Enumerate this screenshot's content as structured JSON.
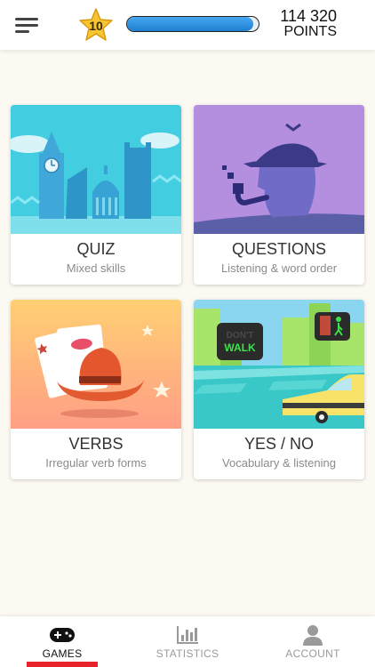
{
  "header": {
    "menu_icon": "hamburger-menu-icon",
    "level": "10",
    "progress_fraction": 0.96,
    "points_value": "114 320",
    "points_label": "POINTS",
    "colors": {
      "star": "#f6c531",
      "progress": "#2b8fe0"
    }
  },
  "games": [
    {
      "id": "quiz",
      "title": "QUIZ",
      "subtitle": "Mixed skills"
    },
    {
      "id": "questions",
      "title": "QUESTIONS",
      "subtitle": "Listening & word order"
    },
    {
      "id": "verbs",
      "title": "VERBS",
      "subtitle": "Irregular verb forms"
    },
    {
      "id": "yesno",
      "title": "YES / NO",
      "subtitle": "Vocabulary & listening",
      "sign_line1": "DON'T",
      "sign_line2": "WALK"
    }
  ],
  "nav": {
    "items": [
      {
        "label": "GAMES",
        "icon": "gamepad-icon",
        "active": true
      },
      {
        "label": "STATISTICS",
        "icon": "bar-chart-icon",
        "active": false
      },
      {
        "label": "ACCOUNT",
        "icon": "user-icon",
        "active": false
      }
    ],
    "active_color": "#e8242a"
  }
}
